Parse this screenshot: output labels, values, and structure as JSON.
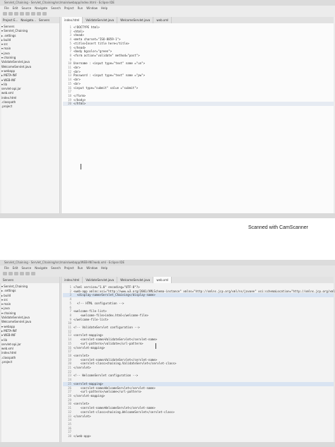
{
  "screen1": {
    "window_title": "Servlet_Chaining - Servlet_Chaining/src/main/webapp/index.html - Eclipse IDE",
    "menu": [
      "File",
      "Edit",
      "Source",
      "Navigate",
      "Search",
      "Project",
      "Run",
      "Window",
      "Help"
    ],
    "explorer_tabs": [
      "Project E...",
      "Navigato...",
      "Servers"
    ],
    "tree": [
      "▾ Servers",
      "▾ Servlet_Chaining",
      "  ▸ .settings",
      "  ▸ build",
      "  ▾ src",
      "    ▾ main",
      "      ▾ java",
      "        ▾ chaining",
      "            ValidateServlet.java",
      "            WelcomeServlet.java",
      "      ▾ webapp",
      "        ▸ META-INF",
      "        ▾ WEB-INF",
      "          ▾ lib",
      "              servlet-api.jar",
      "            web.xml",
      "          index.html",
      "  .classpath",
      "  .project"
    ],
    "editor_tabs": [
      "index.html",
      "ValidateServlet.java",
      "WelcomeServlet.java",
      "web.xml"
    ],
    "code_lines": [
      {
        "n": "1",
        "t": "<!DOCTYPE html>"
      },
      {
        "n": "2",
        "t": "<html>"
      },
      {
        "n": "3",
        "t": "<head>"
      },
      {
        "n": "4",
        "t": "<meta charset=\"ISO-8859-1\">"
      },
      {
        "n": "5",
        "t": "<title>Insert title here</title>"
      },
      {
        "n": "6",
        "t": "</head>"
      },
      {
        "n": "7",
        "t": "<body bgcolor=\"green\">"
      },
      {
        "n": "8",
        "t": "<form action=\"validate\" method=\"post\">"
      },
      {
        "n": "9",
        "t": ""
      },
      {
        "n": "10",
        "t": "Username : <input type=\"text\" name =\"un\">"
      },
      {
        "n": "11",
        "t": "<br>"
      },
      {
        "n": "12",
        "t": "<br>"
      },
      {
        "n": "13",
        "t": "Password : <input type=\"text\" name =\"pw\">"
      },
      {
        "n": "14",
        "t": "<br>"
      },
      {
        "n": "15",
        "t": "<br>"
      },
      {
        "n": "16",
        "t": "<input type=\"submit\" value =\"submit\">"
      },
      {
        "n": "17",
        "t": ""
      },
      {
        "n": "18",
        "t": "</form>"
      },
      {
        "n": "19",
        "t": "</body>"
      },
      {
        "n": "20",
        "t": "</html>"
      }
    ]
  },
  "scanner_watermark": "Scanned with CamScanner",
  "screen2": {
    "window_title": "Servlet_Chaining - Servlet_Chaining/src/main/webapp/WEB-INF/web.xml - Eclipse IDE",
    "menu": [
      "File",
      "Edit",
      "Source",
      "Navigate",
      "Search",
      "Project",
      "Run",
      "Window",
      "Help"
    ],
    "explorer_tabs": [
      "Servers"
    ],
    "tree": [
      "▾ Servlet_Chaining",
      "  ▸ .settings",
      "  ▸ build",
      "  ▾ src",
      "    ▾ main",
      "      ▾ java",
      "        ▾ chaining",
      "            ValidateServlet.java",
      "            WelcomeServlet.java",
      "      ▾ webapp",
      "        ▸ META-INF",
      "        ▾ WEB-INF",
      "          ▾ lib",
      "              servlet-api.jar",
      "            web.xml",
      "          index.html",
      "  .classpath",
      "  .project"
    ],
    "editor_tabs": [
      "index.html",
      "ValidateServlet.java",
      "WelcomeServlet.java",
      "web.xml"
    ],
    "code_lines": [
      {
        "n": "1",
        "t": "<?xml version=\"1.0\" encoding=\"UTF-8\"?>"
      },
      {
        "n": "2",
        "t": "<web-app xmlns:xsi=\"http://www.w3.org/2001/XMLSchema-instance\" xmlns=\"http://xmlns.jcp.org/xml/ns/javaee\" xsi:schemaLocation=\"http://xmlns.jcp.org/xml/ns/javaee http://xmlns.jcp.org/xml/ns/javaee/web-app_4_0.xsd\" id=\"WebApp_ID\" version=\"4.0\">"
      },
      {
        "n": "3",
        "t": "  <display-name>Servlet_Chaining</display-name>"
      },
      {
        "n": "4",
        "t": ""
      },
      {
        "n": "5",
        "t": "  <!-- HTML configuration -->"
      },
      {
        "n": "6",
        "t": ""
      },
      {
        "n": "7",
        "t": "<welcome-file-list>"
      },
      {
        "n": "8",
        "t": "    <welcome-file>index.html</welcome-file>"
      },
      {
        "n": "9",
        "t": "</welcome-file-list>"
      },
      {
        "n": "10",
        "t": ""
      },
      {
        "n": "11",
        "t": "<!-- ValidateServlet configuration -->"
      },
      {
        "n": "12",
        "t": ""
      },
      {
        "n": "13",
        "t": "<servlet-mapping>"
      },
      {
        "n": "14",
        "t": "    <servlet-name>ValidateServlet</servlet-name>"
      },
      {
        "n": "15",
        "t": "    <url-pattern>/validate</url-pattern>"
      },
      {
        "n": "16",
        "t": "</servlet-mapping>"
      },
      {
        "n": "17",
        "t": ""
      },
      {
        "n": "18",
        "t": "<servlet>"
      },
      {
        "n": "19",
        "t": "    <servlet-name>ValidateServlet</servlet-name>"
      },
      {
        "n": "20",
        "t": "    <servlet-class>chaining.ValidateServlet</servlet-class>"
      },
      {
        "n": "21",
        "t": "</servlet>"
      },
      {
        "n": "22",
        "t": ""
      },
      {
        "n": "23",
        "t": "<!-- WelcomeServlet configuration -->"
      },
      {
        "n": "24",
        "t": ""
      },
      {
        "n": "25",
        "t": "<servlet-mapping>"
      },
      {
        "n": "26",
        "t": "    <servlet-name>WelcomeServlet</servlet-name>"
      },
      {
        "n": "27",
        "t": "    <url-pattern>/welcome</url-pattern>"
      },
      {
        "n": "28",
        "t": "</servlet-mapping>"
      },
      {
        "n": "29",
        "t": ""
      },
      {
        "n": "30",
        "t": "<servlet>"
      },
      {
        "n": "31",
        "t": "    <servlet-name>WelcomeServlet</servlet-name>"
      },
      {
        "n": "32",
        "t": "    <servlet-class>chaining.WelcomeServlet</servlet-class>"
      },
      {
        "n": "33",
        "t": "</servlet>"
      },
      {
        "n": "34",
        "t": ""
      },
      {
        "n": "35",
        "t": ""
      },
      {
        "n": "36",
        "t": ""
      },
      {
        "n": "37",
        "t": ""
      },
      {
        "n": "38",
        "t": "</web-app>"
      }
    ]
  }
}
